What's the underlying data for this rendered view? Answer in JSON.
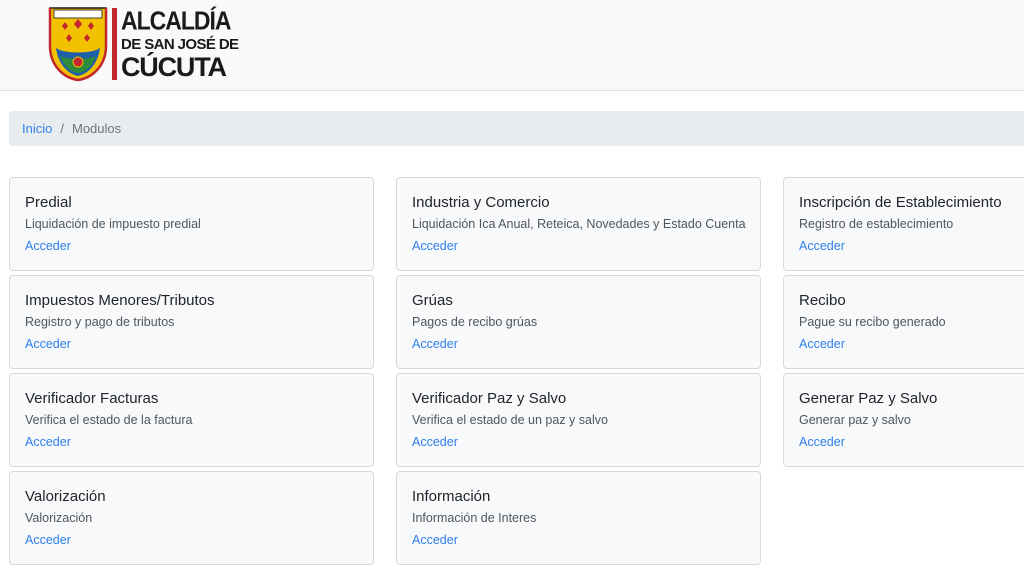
{
  "header": {
    "logo": {
      "line1": "ALCALDÍA",
      "line2": "DE SAN JOSÉ DE",
      "line3": "CÚCUTA",
      "colors": {
        "gold": "#f2c200",
        "red": "#c1272d",
        "blue": "#1f5fa8",
        "green": "#2e8b3a"
      }
    }
  },
  "breadcrumb": {
    "home": "Inicio",
    "separator": "/",
    "current": "Modulos"
  },
  "colors": {
    "link": "#2f80ed",
    "card_bg": "#f8f9fa",
    "breadcrumb_bg": "#e9ecef"
  },
  "modules": [
    {
      "title": "Predial",
      "description": "Liquidación de impuesto predial",
      "action": "Acceder"
    },
    {
      "title": "Industria y Comercio",
      "description": "Liquidación Ica Anual, Reteica, Novedades y Estado Cuenta",
      "action": "Acceder"
    },
    {
      "title": "Inscripción de Establecimiento",
      "description": "Registro de establecimiento",
      "action": "Acceder"
    },
    {
      "title": "Impuestos Menores/Tributos",
      "description": "Registro y pago de tributos",
      "action": "Acceder"
    },
    {
      "title": "Grúas",
      "description": "Pagos de recibo grúas",
      "action": "Acceder"
    },
    {
      "title": "Recibo",
      "description": "Pague su recibo generado",
      "action": "Acceder"
    },
    {
      "title": "Verificador Facturas",
      "description": "Verifica el estado de la factura",
      "action": "Acceder"
    },
    {
      "title": "Verificador Paz y Salvo",
      "description": "Verifica el estado de un paz y salvo",
      "action": "Acceder"
    },
    {
      "title": "Generar Paz y Salvo",
      "description": "Generar paz y salvo",
      "action": "Acceder"
    },
    {
      "title": "Valorización",
      "description": "Valorización",
      "action": "Acceder"
    },
    {
      "title": "Información",
      "description": "Información de Interes",
      "action": "Acceder"
    }
  ]
}
